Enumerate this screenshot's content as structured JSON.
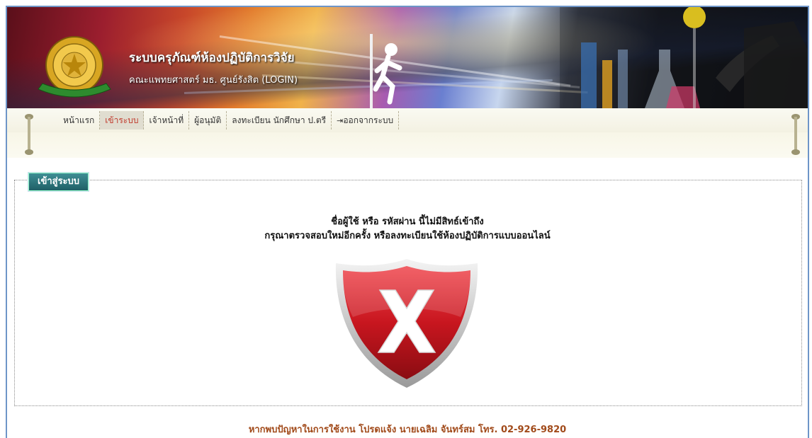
{
  "header": {
    "title": "ระบบครุภัณฑ์ห้องปฏิบัติการวิจัย",
    "subtitle": "คณะแพทยศาสตร์ มธ. ศูนย์รังสิต (LOGIN)"
  },
  "menu": {
    "items": [
      {
        "label": "หน้าแรก",
        "active": false
      },
      {
        "label": "เข้าระบบ",
        "active": true
      },
      {
        "label": "เจ้าหน้าที่",
        "active": false
      },
      {
        "label": "ผู้อนุมัติ",
        "active": false
      },
      {
        "label": "ลงทะเบียน นักศึกษา ป.ตรี",
        "active": false
      },
      {
        "label": "ออกจากระบบ",
        "active": false,
        "icon": "logout-icon"
      }
    ]
  },
  "login_panel": {
    "legend": "เข้าสู่ระบบ",
    "message_line1": "ชื่อผู้ใช้ หรือ รหัสผ่าน นี้ไม่มีสิทธ์เข้าถึง",
    "message_line2": "กรุณาตรวจสอบใหม่อีกครั้ง หรือลงทะเบียนใช้ห้องปฏิบัติการแบบออนไลน์",
    "icon": "error-shield-icon"
  },
  "footer": {
    "text": "หากพบปัญหาในการใช้งาน โปรดแจ้ง นายเฉลิม จันทร์สม โทร. 02-926-9820"
  },
  "colors": {
    "frame_border": "#6e95c8",
    "active_menu": "#c0392b",
    "legend_bg": "#2a6f76",
    "footer_text": "#a14a1a",
    "shield_red": "#d11f2a"
  }
}
